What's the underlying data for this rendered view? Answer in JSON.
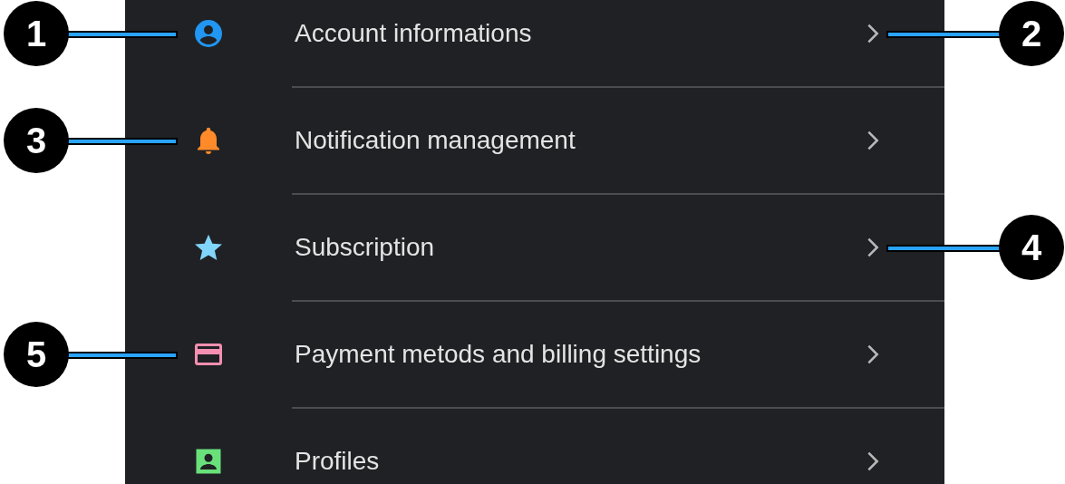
{
  "menu_items": [
    {
      "label": "Account informations",
      "kind": "person",
      "color": "#2196f3",
      "icon_callout": "1",
      "chevron_callout": "2"
    },
    {
      "label": "Notification management",
      "kind": "bell",
      "color": "#ff8a2a",
      "icon_callout": "3"
    },
    {
      "label": "Subscription",
      "kind": "star",
      "color": "#81d4fa",
      "chevron_callout": "4"
    },
    {
      "label": "Payment metods and billing settings",
      "kind": "card",
      "color": "#f48fb1",
      "icon_callout": "5"
    },
    {
      "label": "Profiles",
      "kind": "portrait",
      "color": "#69e07a"
    }
  ]
}
